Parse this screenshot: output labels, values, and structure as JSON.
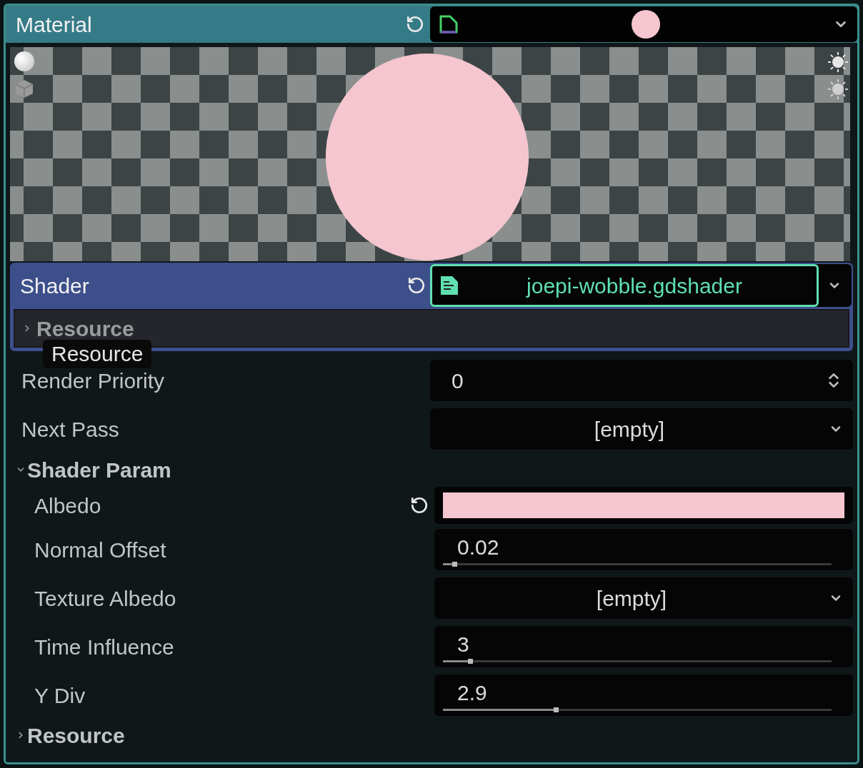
{
  "material": {
    "label": "Material"
  },
  "shader": {
    "label": "Shader",
    "file": "joepi-wobble.gdshader",
    "resource_section": {
      "label": "Resource",
      "expanded": false
    }
  },
  "tooltip": {
    "text": "Resource"
  },
  "render_priority": {
    "label": "Render Priority",
    "value": "0"
  },
  "next_pass": {
    "label": "Next Pass",
    "value": "[empty]"
  },
  "shader_param": {
    "label": "Shader Param",
    "expanded": true,
    "params": [
      {
        "kind": "color",
        "label": "Albedo",
        "color": "#f5c6cf"
      },
      {
        "kind": "slider",
        "label": "Normal Offset",
        "value": "0.02",
        "level": 0.03
      },
      {
        "kind": "resource",
        "label": "Texture Albedo",
        "value": "[empty]"
      },
      {
        "kind": "slider",
        "label": "Time Influence",
        "value": "3",
        "level": 0.07
      },
      {
        "kind": "slider",
        "label": "Y Div",
        "value": "2.9",
        "level": 0.29
      }
    ]
  },
  "resource": {
    "label": "Resource",
    "expanded": false
  }
}
